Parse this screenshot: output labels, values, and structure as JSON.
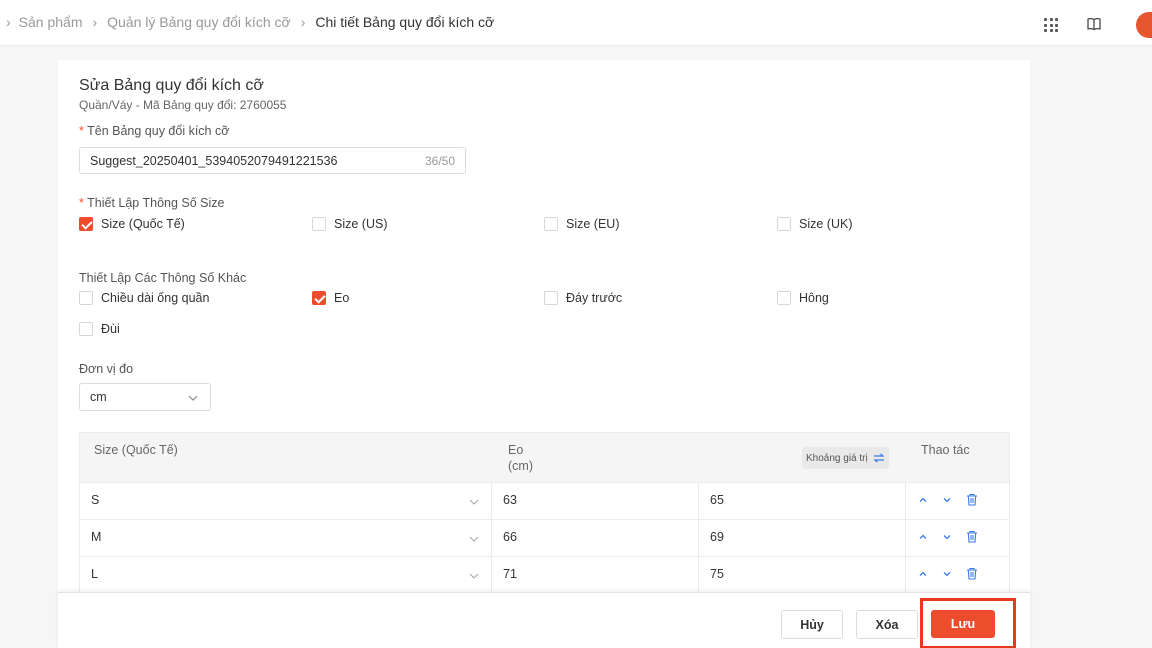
{
  "breadcrumb": {
    "items": [
      "Sản phẩm",
      "Quản lý Bảng quy đổi kích cỡ"
    ],
    "current": "Chi tiết Bảng quy đổi kích cỡ"
  },
  "form": {
    "title": "Sửa Bảng quy đổi kích cỡ",
    "subtitle": "Quần/Váy - Mã Bảng quy đổi: 2760055",
    "name_label": "Tên Bảng quy đổi kích cỡ",
    "name_value": "Suggest_20250401_5394052079491221536",
    "name_count": "36/50",
    "size_setup_label": "Thiết Lập Thông Số Size",
    "size_options": [
      {
        "label": "Size (Quốc Tế)",
        "checked": true
      },
      {
        "label": "Size (US)",
        "checked": false
      },
      {
        "label": "Size (EU)",
        "checked": false
      },
      {
        "label": "Size (UK)",
        "checked": false
      }
    ],
    "other_setup_label": "Thiết Lập Các Thông Số Khác",
    "other_options": [
      {
        "label": "Chiều dài ống quần",
        "checked": false
      },
      {
        "label": "Eo",
        "checked": true
      },
      {
        "label": "Đáy trước",
        "checked": false
      },
      {
        "label": "Hông",
        "checked": false
      },
      {
        "label": "Đùi",
        "checked": false
      }
    ],
    "unit_label": "Đơn vị đo",
    "unit_value": "cm"
  },
  "table": {
    "headers": {
      "size": "Size (Quốc Tế)",
      "eo": "Eo",
      "eo_unit": "(cm)",
      "range_button": "Khoảng giá trị",
      "actions": "Thao tác"
    },
    "rows": [
      {
        "size": "S",
        "min": "63",
        "max": "65"
      },
      {
        "size": "M",
        "min": "66",
        "max": "69"
      },
      {
        "size": "L",
        "min": "71",
        "max": "75"
      }
    ]
  },
  "footer": {
    "cancel": "Hủy",
    "delete": "Xóa",
    "save": "Lưu"
  },
  "colors": {
    "accent": "#ee4d2d",
    "highlight": "#e8391e"
  }
}
